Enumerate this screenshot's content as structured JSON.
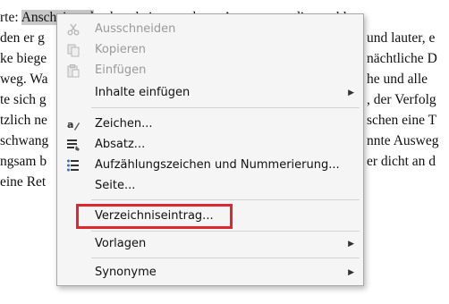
{
  "document": {
    "lines": [
      "rte: ",
      "Anscheinend",
      " gab es keinen anderen Ausweg aus diesem kl",
      " den er g",
      "und lauter, e",
      "ke biege",
      "nächtliche D",
      "weg. Wa",
      "he und alle",
      "te sich g",
      ", der Verfolg",
      "tzlich ne",
      "schen eine T",
      "schwang",
      "nnte Ausweg",
      "ngsam b",
      "er dicht an d",
      "eine Ret"
    ]
  },
  "menu": {
    "items": [
      {
        "label": "Ausschneiden",
        "icon": "scissors-icon"
      },
      {
        "label": "Kopieren",
        "icon": "copy-icon"
      },
      {
        "label": "Einfügen",
        "icon": "paste-icon"
      },
      {
        "label": "Inhalte einfügen"
      },
      {
        "label": "Zeichen..."
      },
      {
        "label": "Absatz..."
      },
      {
        "label": "Aufzählungszeichen und Nummerierung..."
      },
      {
        "label": "Seite..."
      },
      {
        "label": "Verzeichniseintrag..."
      },
      {
        "label": "Vorlagen"
      },
      {
        "label": "Synonyme"
      }
    ],
    "submenu_arrow": "▶"
  },
  "colors": {
    "highlight_border": "#e0262e",
    "disabled_text": "#9a9a9a"
  }
}
